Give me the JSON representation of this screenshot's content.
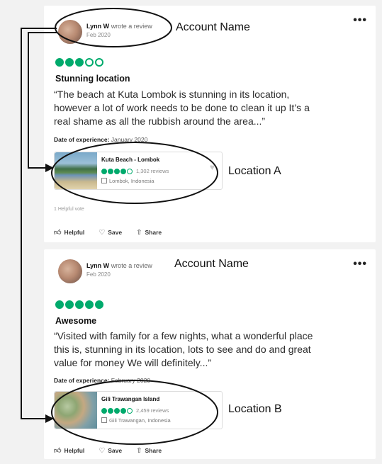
{
  "reviews": [
    {
      "author": "Lynn W",
      "action": "wrote a review",
      "date": "Feb 2020",
      "more": "•••",
      "rating": 3,
      "title": "Stunning location",
      "body_lines": [
        "“The beach at Kuta Lombok is stunning in its location,",
        "however a lot of work needs to be done to clean it up It’s a",
        "real shame as all the rubbish around the area...”"
      ],
      "experience_label": "Date of experience:",
      "experience_value": "January 2020",
      "location": {
        "name": "Kuta Beach - Lombok",
        "rating": 4,
        "reviews": "1,302 reviews",
        "address": "Lombok, Indonesia"
      },
      "helpful_votes": "1 Helpful vote",
      "actions": {
        "helpful": "Helpful",
        "save": "Save",
        "share": "Share"
      }
    },
    {
      "author": "Lynn W",
      "action": "wrote a review",
      "date": "Feb 2020",
      "more": "•••",
      "rating": 5,
      "title": "Awesome",
      "body_lines": [
        "“Visited with family for a few nights, what a wonderful place",
        "this is, stunning in its location, lots to see and do and great",
        "value for money We will definitely...”"
      ],
      "experience_label": "Date of experience:",
      "experience_value": "February 2020",
      "location": {
        "name": "Gili Trawangan Island",
        "rating": 4,
        "reviews": "2,459 reviews",
        "address": "Gili Trawangan, Indonesia"
      },
      "actions": {
        "helpful": "Helpful",
        "save": "Save",
        "share": "Share"
      }
    }
  ],
  "annotations": {
    "account_name_1": "Account Name",
    "location_a": "Location A",
    "account_name_2": "Account Name",
    "location_b": "Location B"
  },
  "colors": {
    "rating_green": "#00aa6c"
  }
}
